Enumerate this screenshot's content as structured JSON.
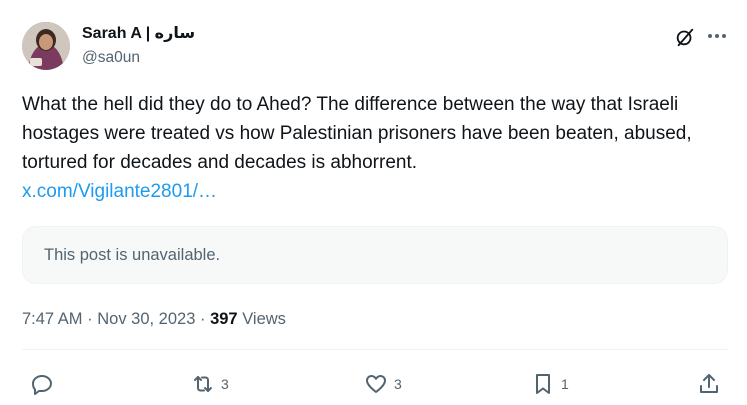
{
  "author": {
    "display_name": "Sarah A | ساره",
    "handle": "@sa0un"
  },
  "tweet": {
    "text": "What the hell did they do to Ahed? The difference between the way that Israeli hostages were treated vs how Palestinian prisoners have been beaten, abused, tortured for decades and decades is abhorrent.",
    "link": "x.com/Vigilante2801/…"
  },
  "quote": {
    "message": "This post is unavailable."
  },
  "meta": {
    "time": "7:47 AM",
    "separator1": "·",
    "date": "Nov 30, 2023",
    "separator2": "·",
    "views": "397",
    "views_label": "Views"
  },
  "actions": {
    "reply": {
      "icon": "reply-icon",
      "count": ""
    },
    "retweet": {
      "icon": "retweet-icon",
      "count": "3"
    },
    "like": {
      "icon": "heart-icon",
      "count": "3"
    },
    "bookmark": {
      "icon": "bookmark-icon",
      "count": "1"
    },
    "share": {
      "icon": "share-icon",
      "count": ""
    }
  },
  "icons": {
    "grok": "grok-icon",
    "more": "more-icon"
  },
  "colors": {
    "text": "#0f1419",
    "secondary": "#536471",
    "link": "#1d9bf0",
    "quote_bg": "#f7f9f9"
  }
}
